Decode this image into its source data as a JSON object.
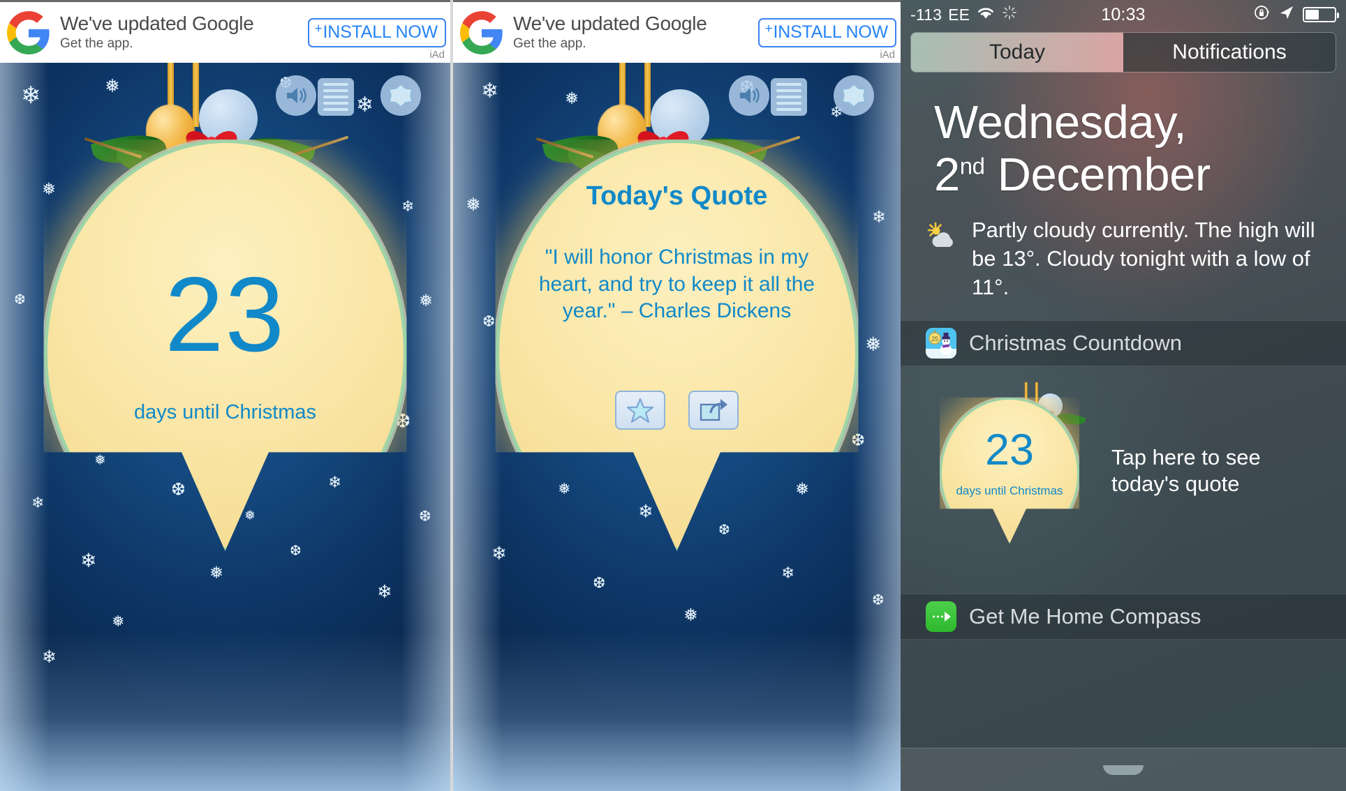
{
  "ad": {
    "headline": "We've updated Google",
    "subline": "Get the app.",
    "install_label": "INSTALL NOW",
    "install_plus": "+",
    "network_label": "iAd",
    "logo_icon": "google-g-icon"
  },
  "app_countdown": {
    "days_number": "23",
    "days_label": "days until Christmas",
    "icons": {
      "sound": "sound-icon",
      "list": "list-icon",
      "settings": "snowflake-settings-icon"
    }
  },
  "app_quote": {
    "title": "Today's Quote",
    "text": "\"I will honor Christmas in my heart, and try to keep it all the year.\" – Charles Dickens",
    "favorite_icon": "star-icon",
    "share_icon": "share-icon"
  },
  "notification_center": {
    "status_bar": {
      "signal": "-113",
      "carrier": "EE",
      "wifi_icon": "wifi-icon",
      "activity_icon": "activity-spinner-icon",
      "time": "10:33",
      "rotation_lock_icon": "rotation-lock-icon",
      "location_icon": "location-arrow-icon",
      "battery_icon": "battery-icon",
      "battery_level": 48
    },
    "tabs": [
      {
        "label": "Today",
        "active": true
      },
      {
        "label": "Notifications",
        "active": false
      }
    ],
    "date": {
      "weekday": "Wednesday,",
      "day": "2",
      "ordinal": "nd",
      "month": "December"
    },
    "weather": {
      "icon": "partly-cloudy-icon",
      "text": "Partly cloudy currently. The high will be 13°. Cloudy tonight with a low of 11°."
    },
    "widgets": [
      {
        "title": "Christmas Countdown",
        "icon": "christmas-countdown-app-icon",
        "days_number": "23",
        "days_label": "days until Christmas",
        "tap_text": "Tap here to see today's quote"
      },
      {
        "title": "Get Me Home Compass",
        "icon": "get-me-home-compass-app-icon"
      }
    ],
    "grabber_icon": "grabber-handle-icon"
  },
  "colors": {
    "accent_blue": "#1189c8",
    "ad_blue": "#2684f7",
    "cream": "#fbe9ad",
    "deep_blue": "#14487e",
    "green_app": "#3cc13c"
  }
}
